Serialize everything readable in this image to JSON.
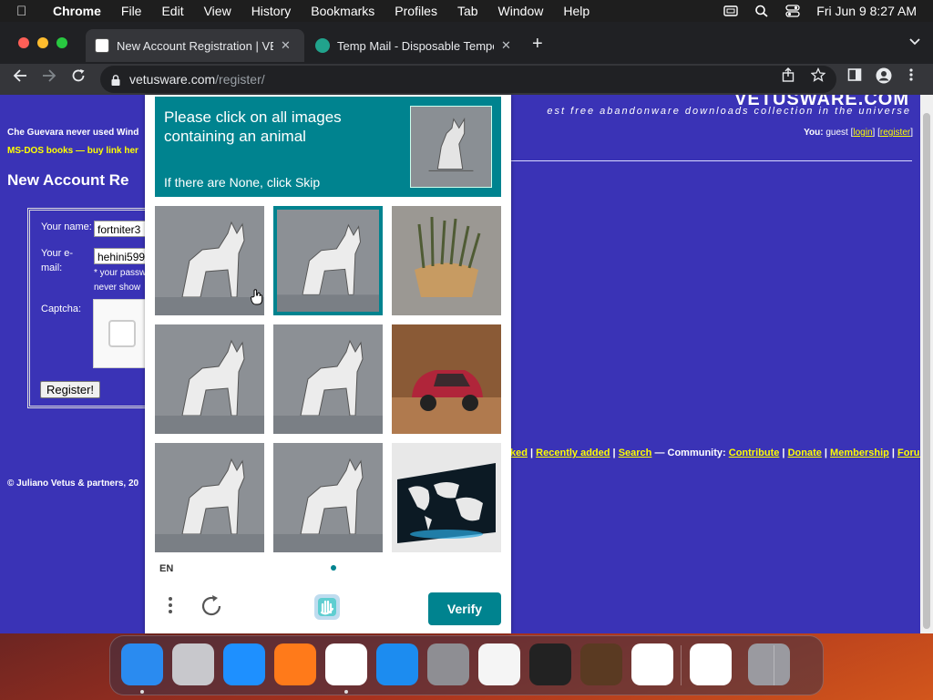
{
  "menubar": {
    "app": "Chrome",
    "items": [
      "File",
      "Edit",
      "View",
      "History",
      "Bookmarks",
      "Profiles",
      "Tab",
      "Window",
      "Help"
    ],
    "clock": "Fri Jun 9  8:27 AM"
  },
  "tabs": [
    {
      "title": "New Account Registration | VE",
      "favicon_color": "#ffffff"
    },
    {
      "title": "Temp Mail - Disposable Tempo",
      "favicon_color": "#21a38c"
    }
  ],
  "omnibox": {
    "host": "vetusware.com",
    "path": "/register/"
  },
  "page": {
    "logo": "VETUSWARE.COM",
    "tagline": "est free abandonware downloads collection in the universe",
    "quote": "Che Guevara never used Wind",
    "books": "MS-DOS books — buy link her",
    "you_label": "You:",
    "you_user": "guest",
    "login": "login",
    "register": "register",
    "heading": "New Account Re",
    "form": {
      "name_label": "Your name:",
      "name_value": "fortniter3",
      "email_label_1": "Your e-",
      "email_label_2": "mail:",
      "email_value": "hehini599",
      "note_1": "* your passw",
      "note_2": "never show",
      "captcha_label": "Captcha:",
      "register_button": "Register!"
    },
    "footer_links": {
      "first": "ked",
      "recent": "Recently added",
      "search": "Search",
      "community": "— Community:",
      "contribute": "Contribute",
      "donate": "Donate",
      "membership": "Membership",
      "forum": "Forum"
    },
    "copyright": "© Juliano Vetus & partners, 20"
  },
  "hcaptcha": {
    "prompt": "Please click on all images containing an animal",
    "sub": "If there are None, click Skip",
    "language": "EN",
    "verify_button": "Verify",
    "tiles": [
      {
        "subject": "cat",
        "selected": false
      },
      {
        "subject": "cat",
        "selected": true
      },
      {
        "subject": "plant",
        "selected": false
      },
      {
        "subject": "cat",
        "selected": false
      },
      {
        "subject": "cat",
        "selected": false
      },
      {
        "subject": "car",
        "selected": false
      },
      {
        "subject": "cat",
        "selected": false
      },
      {
        "subject": "cat",
        "selected": false
      },
      {
        "subject": "map",
        "selected": false
      }
    ],
    "accent": "#00838f"
  },
  "dock": {
    "apps": [
      {
        "name": "Finder",
        "color": "#2a8bf0",
        "running": true
      },
      {
        "name": "Launchpad",
        "color": "#c8c8cc",
        "running": false
      },
      {
        "name": "Safari",
        "color": "#1e90ff",
        "running": false
      },
      {
        "name": "Firefox",
        "color": "#ff7a1a",
        "running": false
      },
      {
        "name": "Chrome",
        "color": "#ffffff",
        "running": true
      },
      {
        "name": "App Store",
        "color": "#1c8cf0",
        "running": false
      },
      {
        "name": "System Preferences",
        "color": "#8e8e93",
        "running": false
      },
      {
        "name": "TextEdit",
        "color": "#f5f5f5",
        "running": false
      },
      {
        "name": "Terminal",
        "color": "#222222",
        "running": false
      },
      {
        "name": "GarageBand",
        "color": "#5a3a22",
        "running": false
      },
      {
        "name": "Visual Studio Code",
        "color": "#ffffff",
        "running": false
      },
      {
        "name": "Visual Studio",
        "color": "#ffffff",
        "running": false
      },
      {
        "name": "Trash",
        "color": "#9a9aa0",
        "running": false
      }
    ]
  }
}
